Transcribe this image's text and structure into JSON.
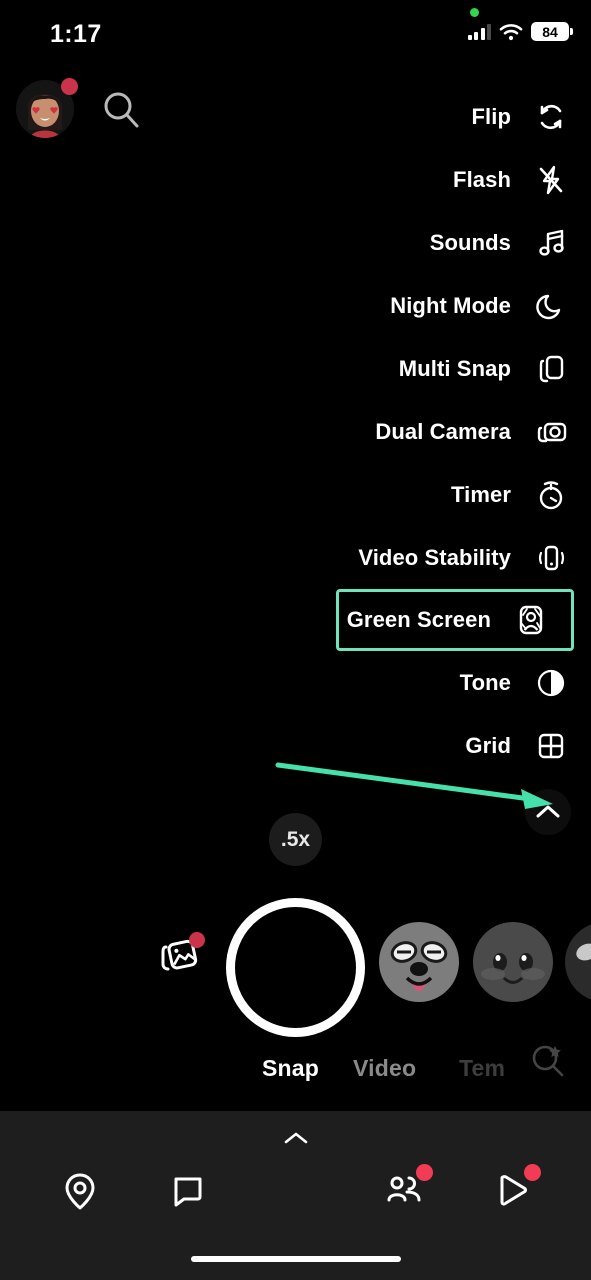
{
  "status_bar": {
    "time": "1:17",
    "battery_level": "84",
    "privacy_dot_color": "#32D74B",
    "signal_icon": "cellular-signal-icon",
    "wifi_icon": "wifi-icon",
    "battery_icon": "battery-icon"
  },
  "top_bar": {
    "avatar_name": "bitmoji-avatar",
    "avatar_badge": true,
    "search_icon": "search-icon"
  },
  "camera_menu": {
    "items": [
      {
        "label": "Flip",
        "icon": "flip-camera-icon",
        "highlighted": false
      },
      {
        "label": "Flash",
        "icon": "flash-off-icon",
        "highlighted": false
      },
      {
        "label": "Sounds",
        "icon": "music-note-icon",
        "highlighted": false
      },
      {
        "label": "Night Mode",
        "icon": "moon-icon",
        "highlighted": false
      },
      {
        "label": "Multi Snap",
        "icon": "multi-snap-icon",
        "highlighted": false
      },
      {
        "label": "Dual Camera",
        "icon": "dual-camera-icon",
        "highlighted": false
      },
      {
        "label": "Timer",
        "icon": "timer-icon",
        "highlighted": false
      },
      {
        "label": "Video Stability",
        "icon": "video-stability-icon",
        "highlighted": false
      },
      {
        "label": "Green Screen",
        "icon": "green-screen-icon",
        "highlighted": true
      },
      {
        "label": "Tone",
        "icon": "tone-contrast-icon",
        "highlighted": false
      },
      {
        "label": "Grid",
        "icon": "grid-icon",
        "highlighted": false
      }
    ],
    "collapse_icon": "chevron-up-icon",
    "highlight_color": "#6FE3BB"
  },
  "annotation": {
    "arrow_color": "#45E0AC",
    "arrow_target": "collapse-menu-button"
  },
  "camera_controls": {
    "zoom_level": ".5x",
    "shutter_name": "shutter-button",
    "memories_icon": "memories-icon",
    "memories_badge": true,
    "lenses": [
      {
        "name": "lens-dog-face"
      },
      {
        "name": "lens-cat-face"
      },
      {
        "name": "lens-partial"
      }
    ]
  },
  "mode_tabs": {
    "tabs": [
      {
        "label": "Snap",
        "active": true
      },
      {
        "label": "Video",
        "active": false
      },
      {
        "label": "Tem",
        "active": false
      }
    ],
    "lens_search_icon": "lens-search-icon"
  },
  "bottom_nav": {
    "chevron_icon": "chevron-up-icon",
    "items": [
      {
        "name": "map-pin-icon",
        "badge": false
      },
      {
        "name": "chat-bubble-icon",
        "badge": false
      },
      {
        "name": "friends-icon",
        "badge": true
      },
      {
        "name": "spotlight-icon",
        "badge": true
      }
    ],
    "badge_color": "#F23C56"
  }
}
